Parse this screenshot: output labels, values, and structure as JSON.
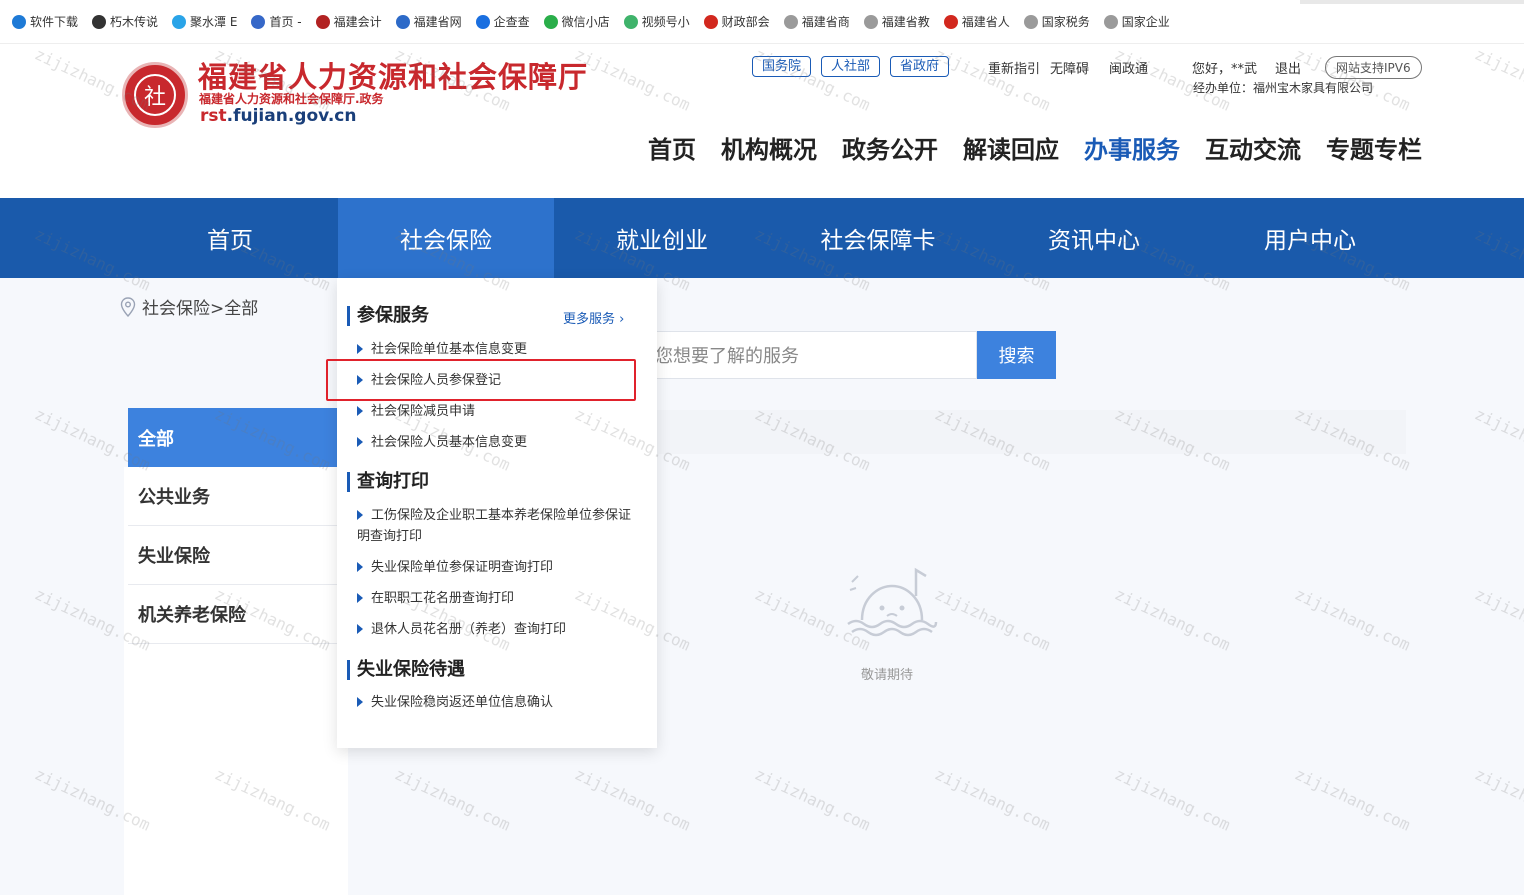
{
  "bookmarks": [
    {
      "label": "软件下载",
      "color": "#1e7ad6"
    },
    {
      "label": "朽木传说",
      "color": "#333333"
    },
    {
      "label": "聚水潭 E",
      "color": "#2aa4e8"
    },
    {
      "label": "首页 -",
      "color": "#3668c8"
    },
    {
      "label": "福建会计",
      "color": "#b22222"
    },
    {
      "label": "福建省网",
      "color": "#2d6ac8"
    },
    {
      "label": "企查查",
      "color": "#1a6fe0"
    },
    {
      "label": "微信小店",
      "color": "#2aae4a"
    },
    {
      "label": "视频号小",
      "color": "#3fb36b"
    },
    {
      "label": "财政部会",
      "color": "#d2281e"
    },
    {
      "label": "福建省商",
      "color": "#9a9a9a"
    },
    {
      "label": "福建省教",
      "color": "#9a9a9a"
    },
    {
      "label": "福建省人",
      "color": "#d2281e"
    },
    {
      "label": "国家税务",
      "color": "#9a9a9a"
    },
    {
      "label": "国家企业",
      "color": "#9a9a9a"
    }
  ],
  "header": {
    "title": "福建省人力资源和社会保障厅",
    "subtitle": "福建省人力资源和社会保障厅.政务",
    "domain_prefix": "rst",
    "domain_rest": ".fujian.gov.cn",
    "gov_links": [
      "国务院",
      "人社部",
      "省政府"
    ],
    "top_links": [
      "重新指引",
      "无障碍",
      "闽政通"
    ],
    "greeting": "您好，**武",
    "logout": "退出",
    "ipv6": "网站支持IPV6",
    "org_unit": "经办单位：福州宝木家具有限公司",
    "nav": [
      "首页",
      "机构概况",
      "政务公开",
      "解读回应",
      "办事服务",
      "互动交流",
      "专题专栏"
    ],
    "nav_active_index": 4
  },
  "bluebar": {
    "items": [
      "首页",
      "社会保险",
      "就业创业",
      "社会保障卡",
      "资讯中心",
      "用户中心"
    ],
    "active_index": 1
  },
  "breadcrumb": "社会保险>全部",
  "sidebar": {
    "items": [
      "全部",
      "公共业务",
      "失业保险",
      "机关养老保险"
    ],
    "active_index": 0
  },
  "search": {
    "placeholder": "您想要了解的服务",
    "button": "搜索"
  },
  "empty_state": "敬请期待",
  "dropdown": {
    "sections": [
      {
        "title": "参保服务",
        "more": "更多服务",
        "items": [
          "社会保险单位基本信息变更",
          "社会保险人员参保登记",
          "社会保险减员申请",
          "社会保险人员基本信息变更"
        ]
      },
      {
        "title": "查询打印",
        "items": [
          "工伤保险及企业职工基本养老保险单位参保证明查询打印",
          "失业保险单位参保证明查询打印",
          "在职职工花名册查询打印",
          "退休人员花名册（养老）查询打印"
        ]
      },
      {
        "title": "失业保险待遇",
        "items": [
          "失业保险稳岗返还单位信息确认"
        ]
      }
    ]
  },
  "watermark": "zijizhang.com"
}
